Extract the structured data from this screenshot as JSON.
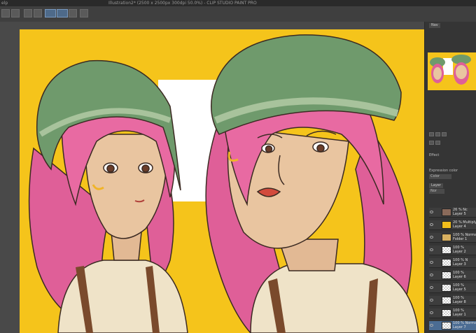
{
  "titlebar": {
    "menu_label": "elp",
    "title": "Illustration2* (2500 x 2500px 300dpi 50.0%) - CLIP STUDIO PAINT PRO"
  },
  "toolbar": {
    "icons": [
      "select-icon",
      "transform-icon",
      "brush-icon",
      "pen-icon",
      "eraser-icon",
      "fill-icon",
      "layer-icon"
    ]
  },
  "right_panel": {
    "navigator_tab": "Nav",
    "layer_tab": "Layer",
    "effect_label": "Effect",
    "expression_color_label": "Expression color",
    "color_value": "Color",
    "blend_value": "Nor",
    "layers": [
      {
        "mode": "26 % Nc",
        "name": "Layer 5",
        "thumb": "#8a6a5a"
      },
      {
        "mode": "20 % Multiply",
        "name": "Layer 4",
        "thumb": "#f2be1c"
      },
      {
        "mode": "100 % Normal",
        "name": "Folder 1",
        "thumb": "folder"
      },
      {
        "mode": "100 %",
        "name": "Layer 2",
        "thumb": "checker"
      },
      {
        "mode": "100 % N",
        "name": "Layer 3",
        "thumb": "checker"
      },
      {
        "mode": "100 %",
        "name": "Layer 6",
        "thumb": "checker"
      },
      {
        "mode": "100 %",
        "name": "Layer 5",
        "thumb": "checker"
      },
      {
        "mode": "100 %",
        "name": "Layer 8",
        "thumb": "checker"
      },
      {
        "mode": "100 %",
        "name": "Layer 1",
        "thumb": "checker"
      },
      {
        "mode": "100 % Normal",
        "name": "Layer 7",
        "thumb": "checker"
      }
    ]
  },
  "colors": {
    "background": "#f5c41b",
    "hat": "#6f9a6c",
    "hair": "#df5f98",
    "skin": "#e9c5a0",
    "shirt": "#efe3c8",
    "suspenders": "#7a4a2c"
  }
}
